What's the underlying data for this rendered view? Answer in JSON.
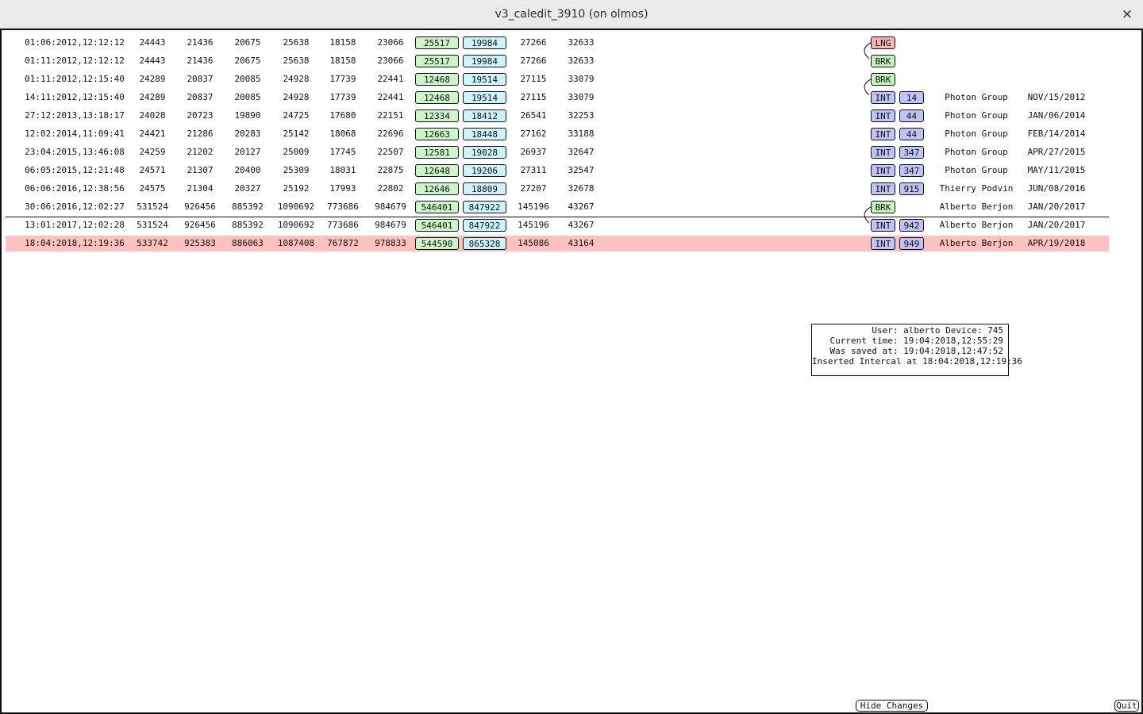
{
  "window": {
    "title": "v3_caledit_3910 (on olmos)",
    "close_glyph": "×"
  },
  "rows": [
    {
      "date": "01:06:2012,12:12:12",
      "v1": "24443",
      "v2": "21436",
      "v3": "20675",
      "v4": "25638",
      "v5": "18158",
      "v6": "23066",
      "g": "25517",
      "c": "19984",
      "v7": "27266",
      "v8": "32633",
      "tag": "LNG",
      "num": "",
      "group": "",
      "rdate": "",
      "current": false
    },
    {
      "date": "01:11:2012,12:12:12",
      "v1": "24443",
      "v2": "21436",
      "v3": "20675",
      "v4": "25638",
      "v5": "18158",
      "v6": "23066",
      "g": "25517",
      "c": "19984",
      "v7": "27266",
      "v8": "32633",
      "tag": "BRK",
      "num": "",
      "group": "",
      "rdate": "",
      "current": false
    },
    {
      "date": "01:11:2012,12:15:40",
      "v1": "24289",
      "v2": "20837",
      "v3": "20085",
      "v4": "24928",
      "v5": "17739",
      "v6": "22441",
      "g": "12468",
      "c": "19514",
      "v7": "27115",
      "v8": "33079",
      "tag": "BRK",
      "num": "",
      "group": "",
      "rdate": "",
      "current": false
    },
    {
      "date": "14:11:2012,12:15:40",
      "v1": "24289",
      "v2": "20837",
      "v3": "20085",
      "v4": "24928",
      "v5": "17739",
      "v6": "22441",
      "g": "12468",
      "c": "19514",
      "v7": "27115",
      "v8": "33079",
      "tag": "INT",
      "num": "14",
      "group": "Photon Group",
      "rdate": "NOV/15/2012",
      "current": false
    },
    {
      "date": "27:12:2013,13:18:17",
      "v1": "24028",
      "v2": "20723",
      "v3": "19890",
      "v4": "24725",
      "v5": "17680",
      "v6": "22151",
      "g": "12334",
      "c": "18412",
      "v7": "26541",
      "v8": "32253",
      "tag": "INT",
      "num": "44",
      "group": "Photon Group",
      "rdate": "JAN/06/2014",
      "current": false
    },
    {
      "date": "12:02:2014,11:09:41",
      "v1": "24421",
      "v2": "21286",
      "v3": "20283",
      "v4": "25142",
      "v5": "18068",
      "v6": "22696",
      "g": "12663",
      "c": "18448",
      "v7": "27162",
      "v8": "33188",
      "tag": "INT",
      "num": "44",
      "group": "Photon Group",
      "rdate": "FEB/14/2014",
      "current": false
    },
    {
      "date": "23:04:2015,13:46:08",
      "v1": "24259",
      "v2": "21202",
      "v3": "20127",
      "v4": "25009",
      "v5": "17745",
      "v6": "22507",
      "g": "12581",
      "c": "19028",
      "v7": "26937",
      "v8": "32647",
      "tag": "INT",
      "num": "347",
      "group": "Photon Group",
      "rdate": "APR/27/2015",
      "current": false
    },
    {
      "date": "06:05:2015,12:21:48",
      "v1": "24571",
      "v2": "21307",
      "v3": "20400",
      "v4": "25309",
      "v5": "18031",
      "v6": "22875",
      "g": "12648",
      "c": "19206",
      "v7": "27311",
      "v8": "32547",
      "tag": "INT",
      "num": "347",
      "group": "Photon Group",
      "rdate": "MAY/11/2015",
      "current": false
    },
    {
      "date": "06:06:2016,12:38:56",
      "v1": "24575",
      "v2": "21304",
      "v3": "20327",
      "v4": "25192",
      "v5": "17993",
      "v6": "22802",
      "g": "12646",
      "c": "18809",
      "v7": "27207",
      "v8": "32678",
      "tag": "INT",
      "num": "915",
      "group": "Thierry Podvin",
      "rdate": "JUN/08/2016",
      "current": false
    },
    {
      "date": "30:06:2016,12:02:27",
      "v1": "531524",
      "v2": "926456",
      "v3": "885392",
      "v4": "1090692",
      "v5": "773686",
      "v6": "984679",
      "g": "546401",
      "c": "847922",
      "v7": "145196",
      "v8": "43267",
      "tag": "BRK",
      "num": "",
      "group": "Alberto Berjon",
      "rdate": "JAN/20/2017",
      "current": false
    },
    {
      "date": "13:01:2017,12:02:28",
      "v1": "531524",
      "v2": "926456",
      "v3": "885392",
      "v4": "1090692",
      "v5": "773686",
      "v6": "984679",
      "g": "546401",
      "c": "847922",
      "v7": "145196",
      "v8": "43267",
      "tag": "INT",
      "num": "942",
      "group": "Alberto Berjon",
      "rdate": "JAN/20/2017",
      "current": false
    },
    {
      "date": "18:04:2018,12:19:36",
      "v1": "533742",
      "v2": "925383",
      "v3": "886063",
      "v4": "1087408",
      "v5": "767872",
      "v6": "978833",
      "g": "544590",
      "c": "865328",
      "v7": "145086",
      "v8": "43164",
      "tag": "INT",
      "num": "949",
      "group": "Alberto Berjon",
      "rdate": "APR/19/2018",
      "current": true
    }
  ],
  "info": {
    "line1": "User: alberto Device: 745",
    "line2": "Current time: 19:04:2018,12:55:29",
    "line3": "Was saved at: 19:04:2018,12:47:52",
    "line4": "Inserted Intercal at 18:04:2018,12:19:36"
  },
  "buttons": {
    "hide_changes": "Hide Changes",
    "quit": "Quit"
  },
  "colors": {
    "lng": "#f6b3b3",
    "brk": "#c3f2bd",
    "int": "#c0c3f7",
    "green_box": "#cdf5c9",
    "cyan_box": "#cdf3fb",
    "current_row": "#ffc0c0"
  }
}
